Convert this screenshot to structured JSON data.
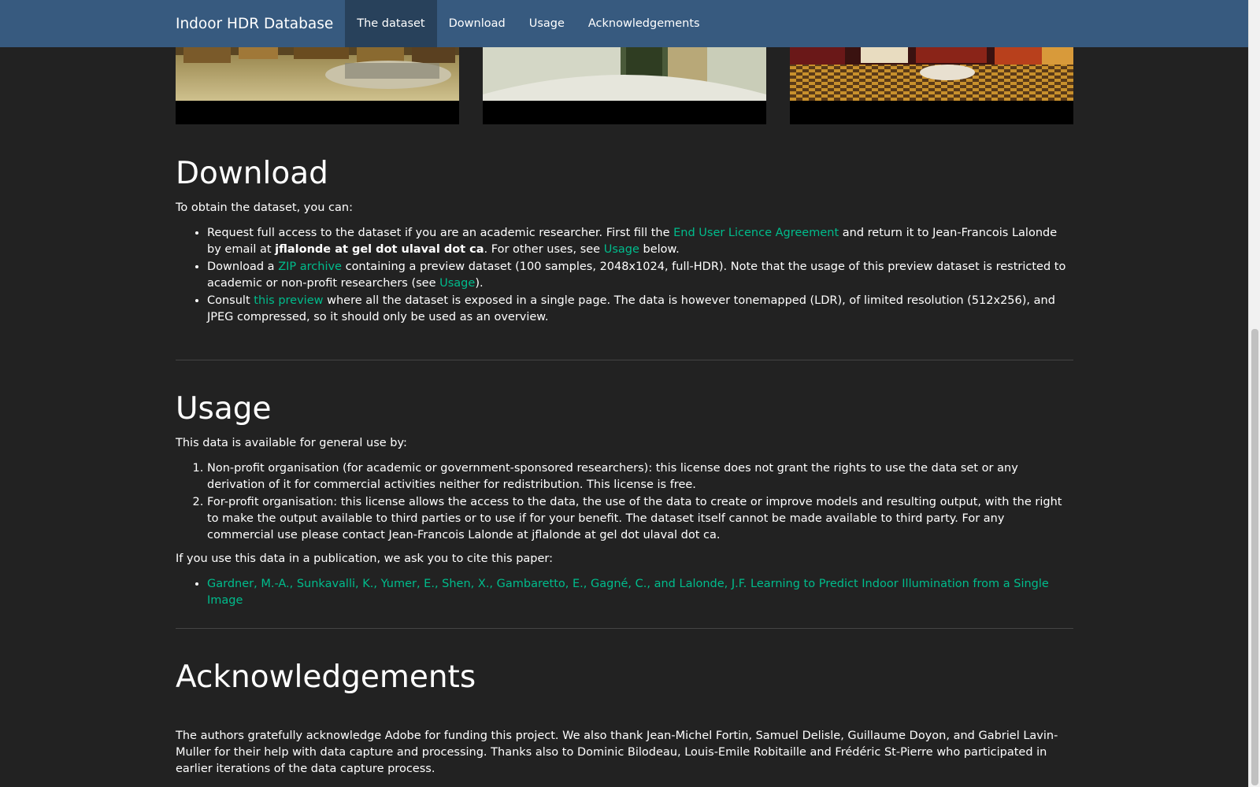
{
  "navbar": {
    "brand": "Indoor HDR Database",
    "items": [
      {
        "label": "The dataset",
        "active": true
      },
      {
        "label": "Download",
        "active": false
      },
      {
        "label": "Usage",
        "active": false
      },
      {
        "label": "Acknowledgements",
        "active": false
      }
    ]
  },
  "download": {
    "heading": "Download",
    "intro": "To obtain the dataset, you can:",
    "item1": {
      "pre": "Request full access to the dataset if you are an academic researcher. First fill the ",
      "link1": "End User Licence Agreement",
      "mid": " and return it to Jean-Francois Lalonde by email at ",
      "email": "jflalonde at gel dot ulaval dot ca",
      "mid2": ". For other uses, see ",
      "link2": "Usage",
      "post": " below."
    },
    "item2": {
      "pre": "Download a ",
      "link1": "ZIP archive",
      "mid": " containing a preview dataset (100 samples, 2048x1024, full-HDR). Note that the usage of this preview dataset is restricted to academic or non-profit researchers (see ",
      "link2": "Usage",
      "post": ")."
    },
    "item3": {
      "pre": "Consult ",
      "link1": "this preview",
      "post": " where all the dataset is exposed in a single page. The data is however tonemapped (LDR), of limited resolution (512x256), and JPEG compressed, so it should only be used as an overview."
    }
  },
  "usage": {
    "heading": "Usage",
    "intro": "This data is available for general use by:",
    "items": [
      "Non-profit organisation (for academic or government-sponsored researchers): this license does not grant the rights to use the data set or any derivation of it for commercial activities neither for redistribution. This license is free.",
      "For-profit organisation: this license allows the access to the data, the use of the data to create or improve models and resulting output, with the right to make the output available to third parties or to use if for your benefit. The dataset itself cannot be made available to third party. For any commercial use please contact Jean-Francois Lalonde at jflalonde at gel dot ulaval dot ca."
    ],
    "cite_intro": "If you use this data in a publication, we ask you to cite this paper:",
    "citation": "Gardner, M.-A., Sunkavalli, K., Yumer, E., Shen, X., Gambaretto, E., Gagné, C., and Lalonde, J.F. Learning to Predict Indoor Illumination from a Single Image"
  },
  "acknowledgements": {
    "heading": "Acknowledgements",
    "text": "The authors gratefully acknowledge Adobe for funding this project. We also thank Jean-Michel Fortin, Samuel Delisle, Guillaume Doyon, and Gabriel Lavin-Muller for their help with data capture and processing. Thanks also to Dominic Bilodeau, Louis-Emile Robitaille and Frédéric St-Pierre who participated in earlier iterations of the data capture process."
  },
  "colors": {
    "navbar": "#375a7f",
    "navbar_active": "#28415b",
    "background": "#222222",
    "link": "#00bc8c"
  }
}
